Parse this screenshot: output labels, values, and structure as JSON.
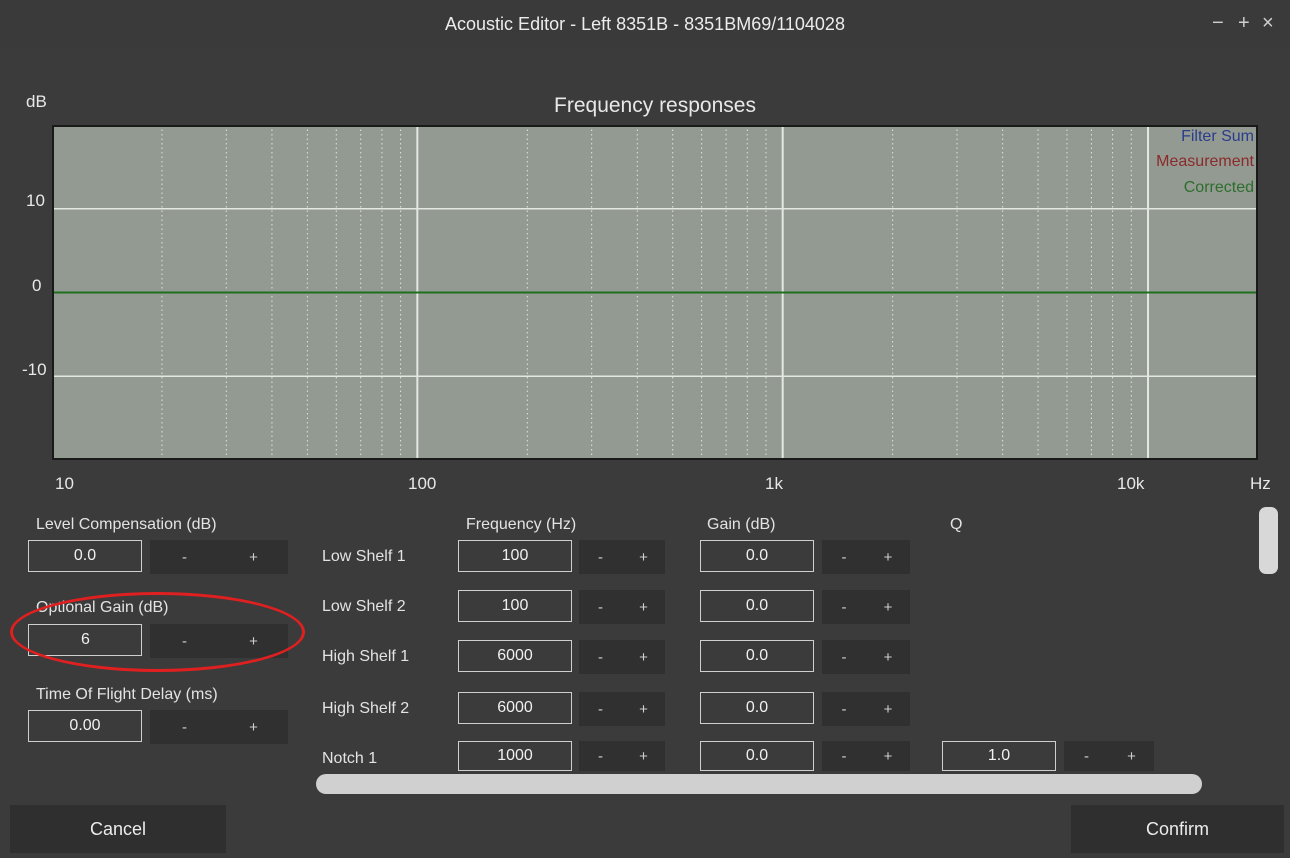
{
  "window": {
    "title": "Acoustic Editor - Left 8351B - 8351BM69/1104028",
    "minimize": "−",
    "maximize": "+",
    "close": "×"
  },
  "chart_data": {
    "type": "line",
    "title": "Frequency responses",
    "ylabel": "dB",
    "xlabel": "Hz",
    "x_scale": "log",
    "xlim": [
      10,
      20000
    ],
    "ylim": [
      -20,
      20
    ],
    "x_ticks": [
      "10",
      "100",
      "1k",
      "10k"
    ],
    "y_ticks": [
      "10",
      "0",
      "-10"
    ],
    "y_tick_values": [
      10,
      0,
      -10
    ],
    "grid": true,
    "legend_placement": "top-right",
    "legend": [
      {
        "name": "Filter Sum",
        "color": "#2a3c8c"
      },
      {
        "name": "Measurement",
        "color": "#8b2a2a"
      },
      {
        "name": "Corrected",
        "color": "#2d6e2d"
      }
    ],
    "series": [
      {
        "name": "Corrected",
        "color": "#1e6e1e",
        "x": [
          10,
          20000
        ],
        "values": [
          0,
          0
        ]
      }
    ]
  },
  "left_panel": {
    "level_comp": {
      "label": "Level Compensation (dB)",
      "value": "0.0",
      "minus": "-",
      "plus": "+"
    },
    "optional_gain": {
      "label": "Optional Gain (dB)",
      "value": "6",
      "minus": "-",
      "plus": "+"
    },
    "tof_delay": {
      "label": "Time Of Flight Delay (ms)",
      "value": "0.00",
      "minus": "-",
      "plus": "+"
    }
  },
  "filters": {
    "headers": {
      "frequency": "Frequency (Hz)",
      "gain": "Gain (dB)",
      "q": "Q"
    },
    "rows": [
      {
        "name": "Low Shelf 1",
        "freq": "100",
        "gain": "0.0",
        "q": ""
      },
      {
        "name": "Low Shelf 2",
        "freq": "100",
        "gain": "0.0",
        "q": ""
      },
      {
        "name": "High Shelf 1",
        "freq": "6000",
        "gain": "0.0",
        "q": ""
      },
      {
        "name": "High Shelf 2",
        "freq": "6000",
        "gain": "0.0",
        "q": ""
      },
      {
        "name": "Notch 1",
        "freq": "1000",
        "gain": "0.0",
        "q": "1.0"
      }
    ],
    "minus": "-",
    "plus": "+"
  },
  "footer": {
    "cancel": "Cancel",
    "confirm": "Confirm"
  },
  "colors": {
    "plot_bg": "#939a92",
    "grid_major": "#e4e8e2",
    "grid_minor": "#dfe3dc",
    "highlight": "#e02020"
  }
}
